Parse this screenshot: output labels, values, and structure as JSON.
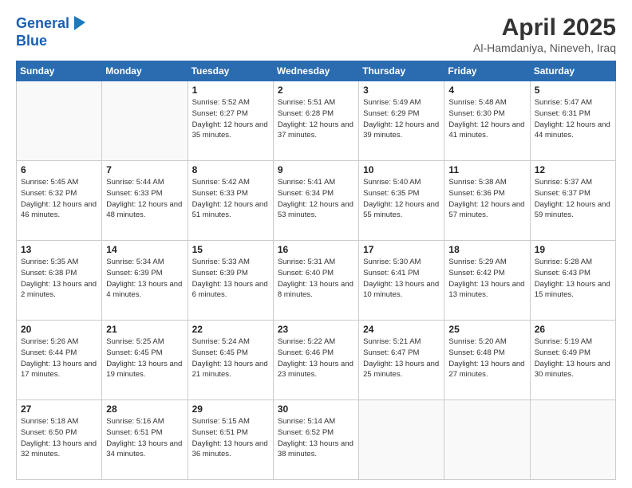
{
  "logo": {
    "line1": "General",
    "line2": "Blue"
  },
  "header": {
    "month": "April 2025",
    "location": "Al-Hamdaniya, Nineveh, Iraq"
  },
  "weekdays": [
    "Sunday",
    "Monday",
    "Tuesday",
    "Wednesday",
    "Thursday",
    "Friday",
    "Saturday"
  ],
  "weeks": [
    [
      {
        "day": "",
        "sunrise": "",
        "sunset": "",
        "daylight": ""
      },
      {
        "day": "",
        "sunrise": "",
        "sunset": "",
        "daylight": ""
      },
      {
        "day": "1",
        "sunrise": "Sunrise: 5:52 AM",
        "sunset": "Sunset: 6:27 PM",
        "daylight": "Daylight: 12 hours and 35 minutes."
      },
      {
        "day": "2",
        "sunrise": "Sunrise: 5:51 AM",
        "sunset": "Sunset: 6:28 PM",
        "daylight": "Daylight: 12 hours and 37 minutes."
      },
      {
        "day": "3",
        "sunrise": "Sunrise: 5:49 AM",
        "sunset": "Sunset: 6:29 PM",
        "daylight": "Daylight: 12 hours and 39 minutes."
      },
      {
        "day": "4",
        "sunrise": "Sunrise: 5:48 AM",
        "sunset": "Sunset: 6:30 PM",
        "daylight": "Daylight: 12 hours and 41 minutes."
      },
      {
        "day": "5",
        "sunrise": "Sunrise: 5:47 AM",
        "sunset": "Sunset: 6:31 PM",
        "daylight": "Daylight: 12 hours and 44 minutes."
      }
    ],
    [
      {
        "day": "6",
        "sunrise": "Sunrise: 5:45 AM",
        "sunset": "Sunset: 6:32 PM",
        "daylight": "Daylight: 12 hours and 46 minutes."
      },
      {
        "day": "7",
        "sunrise": "Sunrise: 5:44 AM",
        "sunset": "Sunset: 6:33 PM",
        "daylight": "Daylight: 12 hours and 48 minutes."
      },
      {
        "day": "8",
        "sunrise": "Sunrise: 5:42 AM",
        "sunset": "Sunset: 6:33 PM",
        "daylight": "Daylight: 12 hours and 51 minutes."
      },
      {
        "day": "9",
        "sunrise": "Sunrise: 5:41 AM",
        "sunset": "Sunset: 6:34 PM",
        "daylight": "Daylight: 12 hours and 53 minutes."
      },
      {
        "day": "10",
        "sunrise": "Sunrise: 5:40 AM",
        "sunset": "Sunset: 6:35 PM",
        "daylight": "Daylight: 12 hours and 55 minutes."
      },
      {
        "day": "11",
        "sunrise": "Sunrise: 5:38 AM",
        "sunset": "Sunset: 6:36 PM",
        "daylight": "Daylight: 12 hours and 57 minutes."
      },
      {
        "day": "12",
        "sunrise": "Sunrise: 5:37 AM",
        "sunset": "Sunset: 6:37 PM",
        "daylight": "Daylight: 12 hours and 59 minutes."
      }
    ],
    [
      {
        "day": "13",
        "sunrise": "Sunrise: 5:35 AM",
        "sunset": "Sunset: 6:38 PM",
        "daylight": "Daylight: 13 hours and 2 minutes."
      },
      {
        "day": "14",
        "sunrise": "Sunrise: 5:34 AM",
        "sunset": "Sunset: 6:39 PM",
        "daylight": "Daylight: 13 hours and 4 minutes."
      },
      {
        "day": "15",
        "sunrise": "Sunrise: 5:33 AM",
        "sunset": "Sunset: 6:39 PM",
        "daylight": "Daylight: 13 hours and 6 minutes."
      },
      {
        "day": "16",
        "sunrise": "Sunrise: 5:31 AM",
        "sunset": "Sunset: 6:40 PM",
        "daylight": "Daylight: 13 hours and 8 minutes."
      },
      {
        "day": "17",
        "sunrise": "Sunrise: 5:30 AM",
        "sunset": "Sunset: 6:41 PM",
        "daylight": "Daylight: 13 hours and 10 minutes."
      },
      {
        "day": "18",
        "sunrise": "Sunrise: 5:29 AM",
        "sunset": "Sunset: 6:42 PM",
        "daylight": "Daylight: 13 hours and 13 minutes."
      },
      {
        "day": "19",
        "sunrise": "Sunrise: 5:28 AM",
        "sunset": "Sunset: 6:43 PM",
        "daylight": "Daylight: 13 hours and 15 minutes."
      }
    ],
    [
      {
        "day": "20",
        "sunrise": "Sunrise: 5:26 AM",
        "sunset": "Sunset: 6:44 PM",
        "daylight": "Daylight: 13 hours and 17 minutes."
      },
      {
        "day": "21",
        "sunrise": "Sunrise: 5:25 AM",
        "sunset": "Sunset: 6:45 PM",
        "daylight": "Daylight: 13 hours and 19 minutes."
      },
      {
        "day": "22",
        "sunrise": "Sunrise: 5:24 AM",
        "sunset": "Sunset: 6:45 PM",
        "daylight": "Daylight: 13 hours and 21 minutes."
      },
      {
        "day": "23",
        "sunrise": "Sunrise: 5:22 AM",
        "sunset": "Sunset: 6:46 PM",
        "daylight": "Daylight: 13 hours and 23 minutes."
      },
      {
        "day": "24",
        "sunrise": "Sunrise: 5:21 AM",
        "sunset": "Sunset: 6:47 PM",
        "daylight": "Daylight: 13 hours and 25 minutes."
      },
      {
        "day": "25",
        "sunrise": "Sunrise: 5:20 AM",
        "sunset": "Sunset: 6:48 PM",
        "daylight": "Daylight: 13 hours and 27 minutes."
      },
      {
        "day": "26",
        "sunrise": "Sunrise: 5:19 AM",
        "sunset": "Sunset: 6:49 PM",
        "daylight": "Daylight: 13 hours and 30 minutes."
      }
    ],
    [
      {
        "day": "27",
        "sunrise": "Sunrise: 5:18 AM",
        "sunset": "Sunset: 6:50 PM",
        "daylight": "Daylight: 13 hours and 32 minutes."
      },
      {
        "day": "28",
        "sunrise": "Sunrise: 5:16 AM",
        "sunset": "Sunset: 6:51 PM",
        "daylight": "Daylight: 13 hours and 34 minutes."
      },
      {
        "day": "29",
        "sunrise": "Sunrise: 5:15 AM",
        "sunset": "Sunset: 6:51 PM",
        "daylight": "Daylight: 13 hours and 36 minutes."
      },
      {
        "day": "30",
        "sunrise": "Sunrise: 5:14 AM",
        "sunset": "Sunset: 6:52 PM",
        "daylight": "Daylight: 13 hours and 38 minutes."
      },
      {
        "day": "",
        "sunrise": "",
        "sunset": "",
        "daylight": ""
      },
      {
        "day": "",
        "sunrise": "",
        "sunset": "",
        "daylight": ""
      },
      {
        "day": "",
        "sunrise": "",
        "sunset": "",
        "daylight": ""
      }
    ]
  ]
}
